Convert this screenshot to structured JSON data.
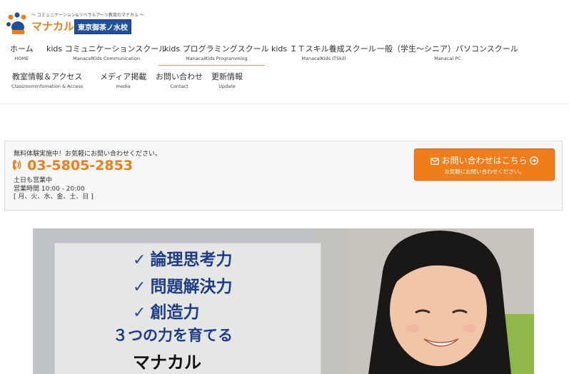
{
  "logo": {
    "tagline": "〜 コミュニケーション&リベラルアーツ教育のマナカル 〜",
    "name": "マナカル",
    "school": "東京御茶ノ水校"
  },
  "nav": {
    "row1": [
      {
        "jp": "ホーム",
        "en": "HOME"
      },
      {
        "jp": "kids コミュニケーションスクール",
        "en": "ManacalKids Communication"
      },
      {
        "jp": "kids プログラミングスクール",
        "en": "ManacalKids Programming"
      },
      {
        "jp": "kids ＩＴスキル養成スクール",
        "en": "ManacalKids ITSkill"
      },
      {
        "jp": "一般（学生〜シニア）パソコンスクール",
        "en": "Manacal PC"
      }
    ],
    "row2": [
      {
        "jp": "教室情報＆アクセス",
        "en": "ClassroomInfomation & Access"
      },
      {
        "jp": "メディア掲載",
        "en": "media"
      },
      {
        "jp": "お問い合わせ",
        "en": "Contact"
      },
      {
        "jp": "更新情報",
        "en": "Update"
      }
    ]
  },
  "contact": {
    "promo": "無料体験実施中！お気軽にお問い合わせください。",
    "phone": "03-5805-2853",
    "hours": [
      "土日も営業中",
      "営業時間 10:00 - 20:00",
      "[ 月、火、水、金、土、日 ]"
    ],
    "cta_main": "お問い合わせはこちら",
    "cta_sub": "お気軽にお問い合わせください。"
  },
  "hero": {
    "lines": [
      "論理思考力",
      "問題解決力",
      "創造力"
    ],
    "tagline": "３つの力を育てる",
    "brand": "マナカル"
  },
  "colors": {
    "accent": "#f07d1a",
    "navy": "#1c3d86",
    "school_badge": "#1f4f9d"
  }
}
